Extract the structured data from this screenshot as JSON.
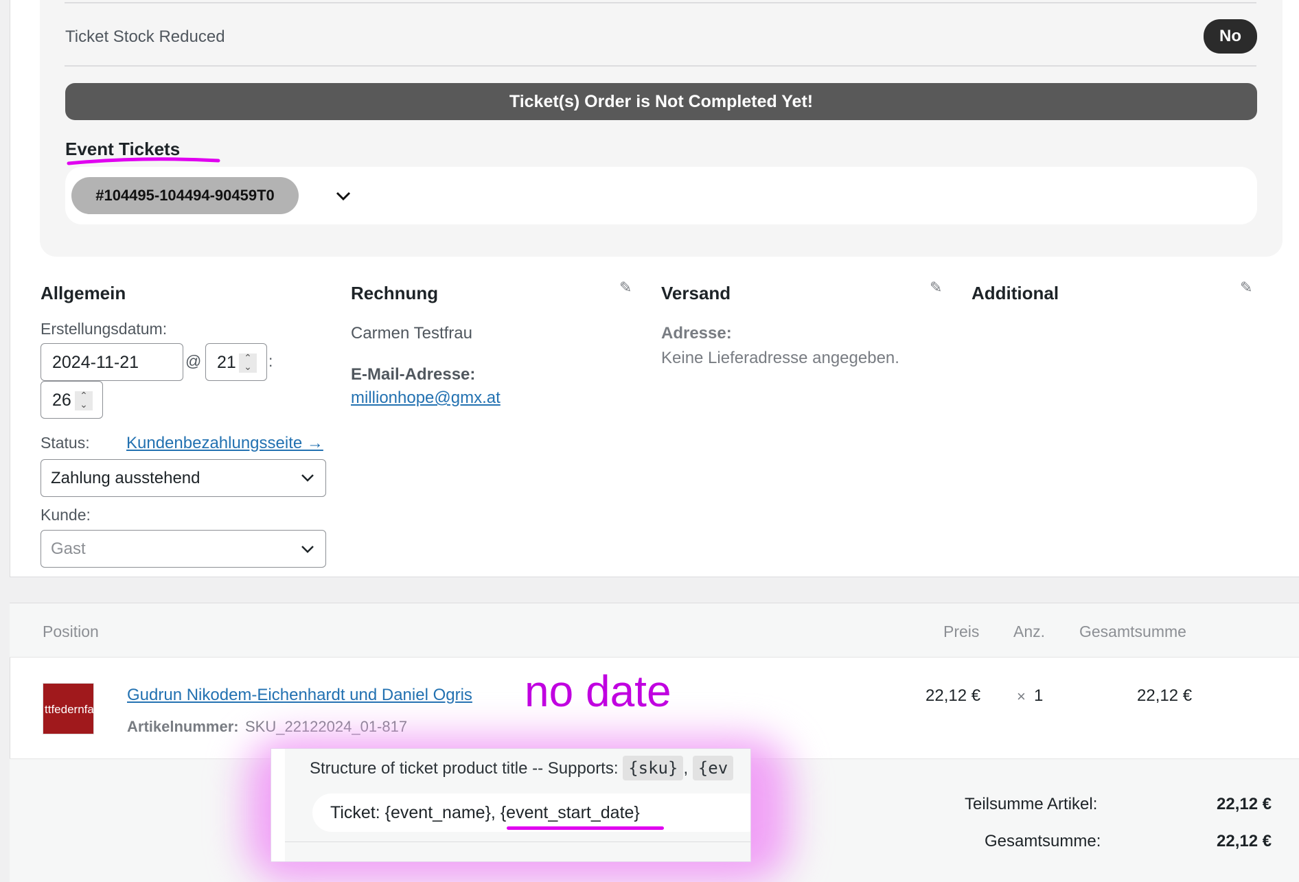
{
  "ticket_panel": {
    "stock_label": "Ticket Stock Reduced",
    "stock_value": "No",
    "banner": "Ticket(s) Order is Not Completed Yet!",
    "event_tickets_heading": "Event Tickets",
    "ticket_id": "#104495-104494-90459T0"
  },
  "general": {
    "title": "Allgemein",
    "date_label": "Erstellungsdatum:",
    "date_value": "2024-11-21",
    "at": "@",
    "hour_value": "21",
    "colon": ":",
    "minute_value": "26",
    "status_label": "Status:",
    "payment_page_link": "Kundenbezahlungsseite →",
    "status_value": "Zahlung ausstehend",
    "customer_label": "Kunde:",
    "customer_value": "Gast"
  },
  "billing": {
    "title": "Rechnung",
    "name": "Carmen Testfrau",
    "email_label": "E-Mail-Adresse:",
    "email": "millionhope@gmx.at"
  },
  "shipping": {
    "title": "Versand",
    "address_label": "Adresse:",
    "address_value": "Keine Lieferadresse angegeben."
  },
  "additional": {
    "title": "Additional"
  },
  "items": {
    "headers": {
      "position": "Position",
      "price": "Preis",
      "qty": "Anz.",
      "total": "Gesamtsumme"
    },
    "rows": [
      {
        "thumb_text": "ttfedernfab",
        "name": "Gudrun Nikodem-Eichenhardt und Daniel Ogris",
        "sku_label": "Artikelnummer:",
        "sku": "SKU_22122024_01-817",
        "price": "22,12 €",
        "qty_prefix": "×",
        "qty": "1",
        "total": "22,12 €"
      }
    ],
    "subtotal_label": "Teilsumme Artikel:",
    "subtotal_value": "22,12 €",
    "total_label": "Gesamtsumme:",
    "total_value": "22,12 €"
  },
  "popup": {
    "title": "Structure of ticket product title -- Supports:",
    "tag_sku": "{sku}",
    "comma": ",",
    "tag_partial": "{ev",
    "input_value": "Ticket: {event_name}, {event_start_date}"
  },
  "annotation": {
    "text": "no date",
    "color": "#c000e0"
  }
}
